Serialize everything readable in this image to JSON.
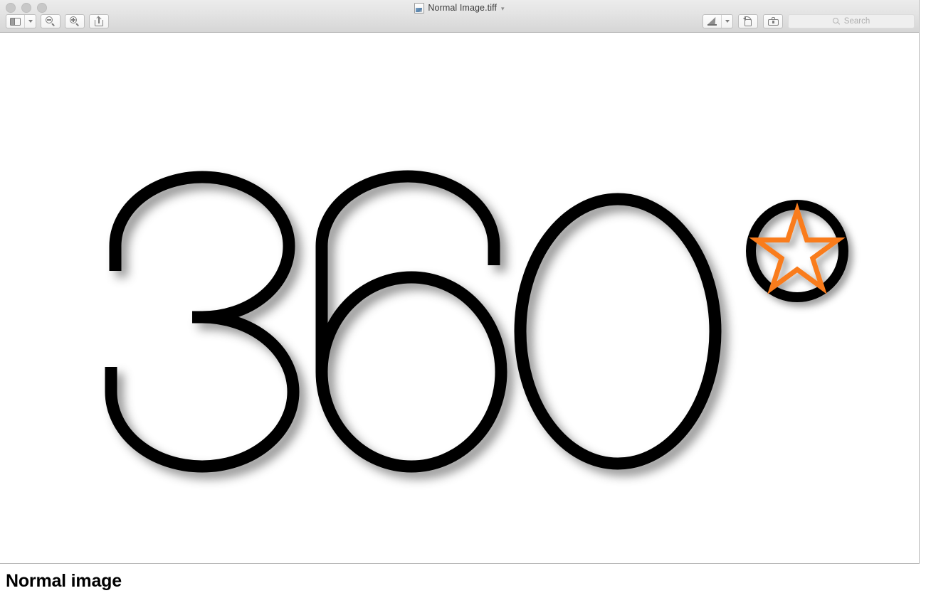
{
  "window": {
    "title": "Normal Image.tiff",
    "title_chevron": "chevron-down-icon",
    "doc_icon": "image-document-icon",
    "traffic_lights": [
      "close-button",
      "minimize-button",
      "zoom-button"
    ]
  },
  "toolbar": {
    "left": [
      {
        "name": "sidebar-toggle-button",
        "icon": "sidebar-icon",
        "has_menu": true
      },
      {
        "name": "zoom-out-button",
        "icon": "magnifier-minus-icon"
      },
      {
        "name": "zoom-in-button",
        "icon": "magnifier-plus-icon"
      },
      {
        "name": "share-button",
        "icon": "share-icon"
      }
    ],
    "right": [
      {
        "name": "markup-pen-button",
        "icon": "pen-icon",
        "has_menu": true
      },
      {
        "name": "rotate-button",
        "icon": "rotate-left-icon"
      },
      {
        "name": "markup-toolbox-button",
        "icon": "toolbox-icon"
      }
    ]
  },
  "search": {
    "placeholder": "Search",
    "value": "",
    "icon": "search-icon"
  },
  "artwork": {
    "text": "360",
    "degree_symbol": "circle-with-star",
    "stroke_color": "#000000",
    "star_color": "#F97C1E",
    "background": "#FFFFFF",
    "shadow": "drop-shadow"
  },
  "caption": {
    "text": "Normal image"
  }
}
